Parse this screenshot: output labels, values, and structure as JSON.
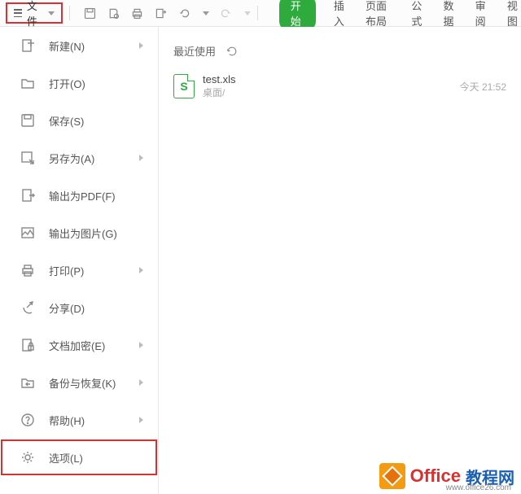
{
  "topbar": {
    "file_label": "文件"
  },
  "tabs": {
    "start": "开始",
    "insert": "插入",
    "page_layout": "页面布局",
    "formulas": "公式",
    "data": "数据",
    "review": "审阅",
    "view": "视图"
  },
  "menu": {
    "new": "新建(N)",
    "open": "打开(O)",
    "save": "保存(S)",
    "save_as": "另存为(A)",
    "export_pdf": "输出为PDF(F)",
    "export_image": "输出为图片(G)",
    "print": "打印(P)",
    "share": "分享(D)",
    "encrypt": "文档加密(E)",
    "backup": "备份与恢复(K)",
    "help": "帮助(H)",
    "options": "选项(L)"
  },
  "recent": {
    "header": "最近使用",
    "file_name": "test.xls",
    "file_path": "桌面/",
    "file_time": "今天 21:52"
  },
  "watermark": {
    "office": "Office",
    "edu": "教程网",
    "url": "www.office26.com"
  }
}
